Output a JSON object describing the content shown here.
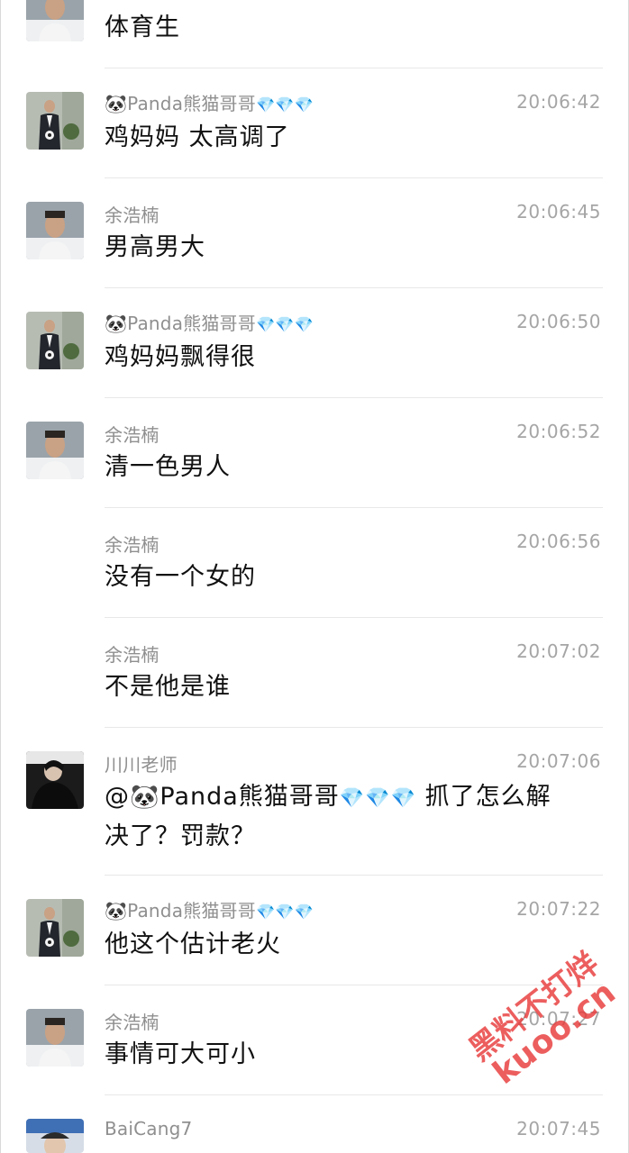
{
  "messages": [
    {
      "id": "m0",
      "name": "",
      "time": "",
      "text": "体育生",
      "avatar": "man-white-shirt"
    },
    {
      "id": "m1",
      "name": "Panda熊猫哥哥",
      "time": "20:06:42",
      "text": "鸡妈妈 太高调了",
      "avatar": "man-suit"
    },
    {
      "id": "m2",
      "name": "余浩楠",
      "time": "20:06:45",
      "text": "男高男大",
      "avatar": "man-white-shirt"
    },
    {
      "id": "m3",
      "name": "Panda熊猫哥哥",
      "time": "20:06:50",
      "text": "鸡妈妈飘得很",
      "avatar": "man-suit"
    },
    {
      "id": "m4",
      "name": "余浩楠",
      "time": "20:06:52",
      "text": "清一色男人",
      "avatar": "man-white-shirt"
    },
    {
      "id": "m5",
      "name": "余浩楠",
      "time": "20:06:56",
      "text": "没有一个女的",
      "avatar": ""
    },
    {
      "id": "m6",
      "name": "余浩楠",
      "time": "20:07:02",
      "text": "不是他是谁",
      "avatar": ""
    },
    {
      "id": "m7",
      "name": "川川老师",
      "time": "20:07:06",
      "mention": "@",
      "mention_name": "Panda熊猫哥哥",
      "text_after": "抓了怎么解",
      "text_line2": "决了？罚款？",
      "avatar": "person-black"
    },
    {
      "id": "m8",
      "name": "Panda熊猫哥哥",
      "time": "20:07:22",
      "text": "他这个估计老火",
      "avatar": "man-suit"
    },
    {
      "id": "m9",
      "name": "余浩楠",
      "time": "20:07:27",
      "text": "事情可大可小",
      "avatar": "man-white-shirt"
    },
    {
      "id": "m10",
      "name": "BaiCang7",
      "time": "20:07:45",
      "text": "",
      "avatar": "person-cap"
    }
  ],
  "emoji": {
    "panda": "🐼",
    "gem": "💎"
  },
  "watermark": {
    "line1": "黑料不打烊",
    "line2": "kuoo.cn",
    "color": "#e83a3a"
  }
}
